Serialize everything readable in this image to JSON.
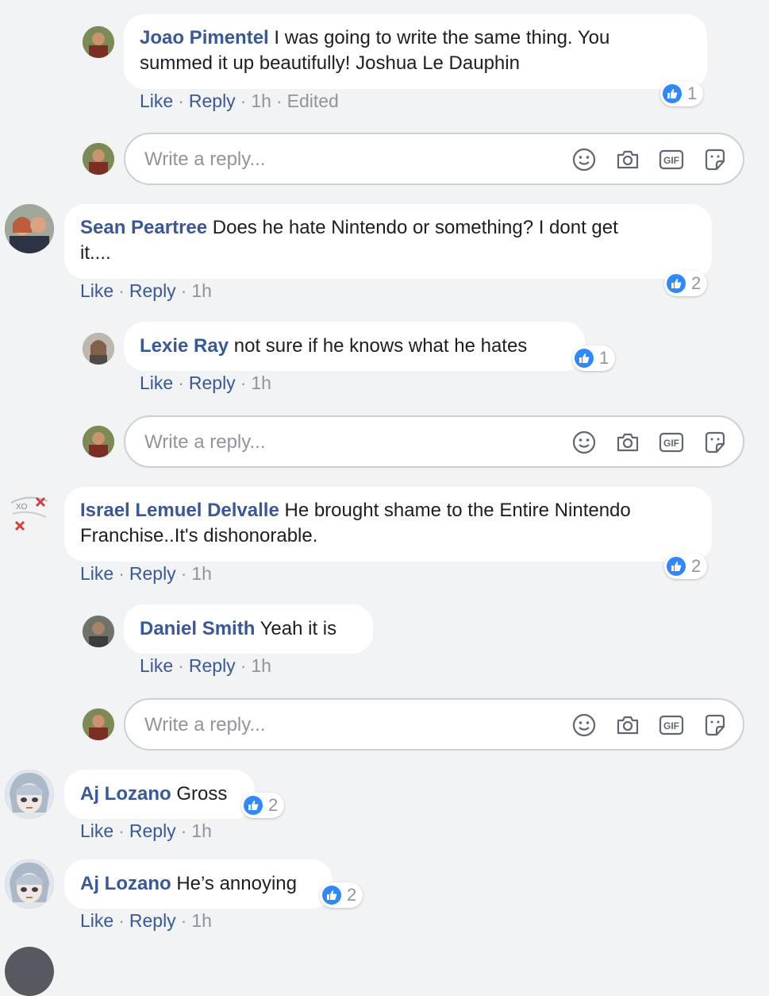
{
  "comments": [
    {
      "author": "Joao Pimentel",
      "text_line1": "I was going to write the same thing. You",
      "text_line2": "summed it up beautifully! Joshua Le Dauphin",
      "like": "Like",
      "reply": "Reply",
      "time": "1h",
      "edited": "Edited",
      "reaction_count": "1"
    },
    {
      "author": "Sean Peartree",
      "text_line1": "Does he hate Nintendo or something? I dont get",
      "text_line2": "it....",
      "like": "Like",
      "reply": "Reply",
      "time": "1h",
      "reaction_count": "2"
    },
    {
      "author": "Lexie Ray",
      "text_line1": "not sure if he knows what he hates",
      "like": "Like",
      "reply": "Reply",
      "time": "1h",
      "reaction_count": "1"
    },
    {
      "author": "Israel Lemuel Delvalle",
      "text_line1": "He brought shame to the Entire Nintendo",
      "text_line2": "Franchise..It's dishonorable.",
      "like": "Like",
      "reply": "Reply",
      "time": "1h",
      "reaction_count": "2"
    },
    {
      "author": "Daniel Smith",
      "text_line1": "Yeah it is",
      "like": "Like",
      "reply": "Reply",
      "time": "1h"
    },
    {
      "author": "Aj Lozano",
      "text_line1": "Gross",
      "like": "Like",
      "reply": "Reply",
      "time": "1h",
      "reaction_count": "2"
    },
    {
      "author": "Aj Lozano",
      "text_line1": "He’s annoying",
      "like": "Like",
      "reply": "Reply",
      "time": "1h",
      "reaction_count": "2"
    }
  ],
  "reply_box": {
    "placeholder": "Write a reply...",
    "icons": [
      "smiley-icon",
      "camera-icon",
      "gif-icon",
      "sticker-icon"
    ],
    "gif_label": "GIF"
  },
  "colors": {
    "author": "#385898",
    "meta": "#90949c",
    "like_blue": "#2e89ff",
    "background": "#f2f3f5"
  }
}
